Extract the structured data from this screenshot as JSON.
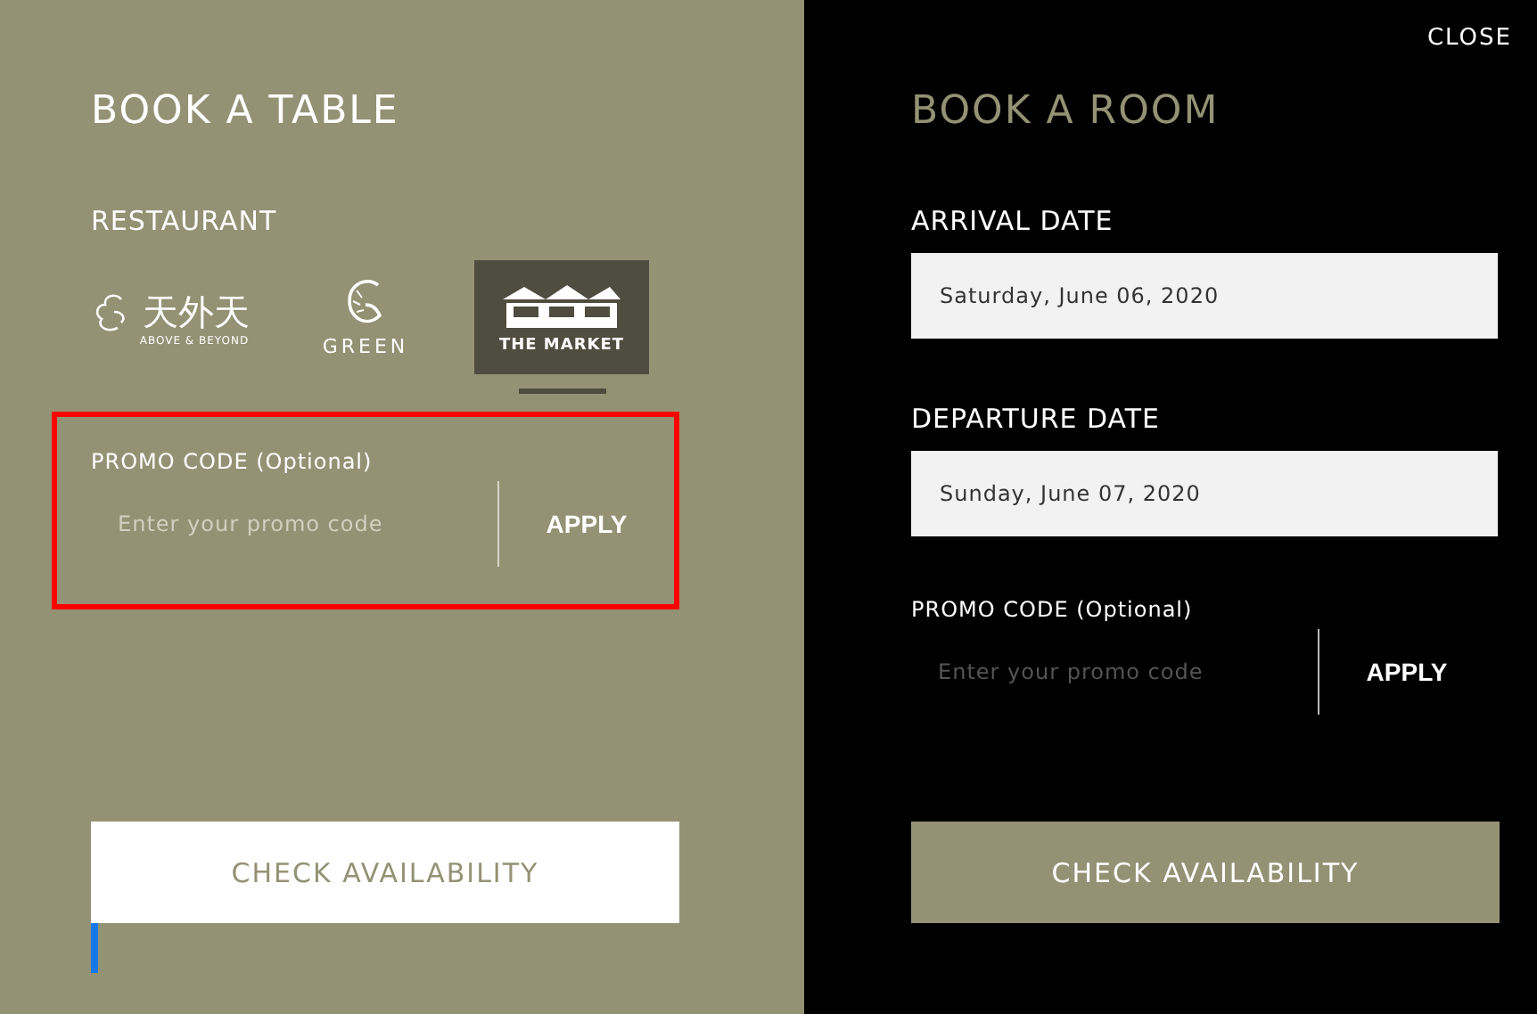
{
  "close_label": "CLOSE",
  "table": {
    "title": "BOOK A TABLE",
    "restaurant_label": "RESTAURANT",
    "restaurants": [
      {
        "kind": "cloud",
        "name": "天外天",
        "tagline": "ABOVE & BEYOND",
        "selected": false
      },
      {
        "kind": "leaf",
        "name": "GREEN",
        "selected": false
      },
      {
        "kind": "market",
        "name": "THE MARKET",
        "selected": true
      }
    ],
    "promo": {
      "label": "PROMO CODE (Optional)",
      "placeholder": "Enter your promo code",
      "button": "APPLY",
      "highlighted": true
    },
    "submit": "CHECK AVAILABILITY",
    "focused": true
  },
  "room": {
    "title": "BOOK A ROOM",
    "fields": [
      {
        "label": "ARRIVAL DATE",
        "value": "Saturday, June 06, 2020"
      },
      {
        "label": "DEPARTURE DATE",
        "value": "Sunday, June 07, 2020"
      }
    ],
    "promo": {
      "label": "PROMO CODE (Optional)",
      "placeholder": "Enter your promo code",
      "button": "APPLY"
    },
    "submit": "CHECK AVAILABILITY"
  }
}
